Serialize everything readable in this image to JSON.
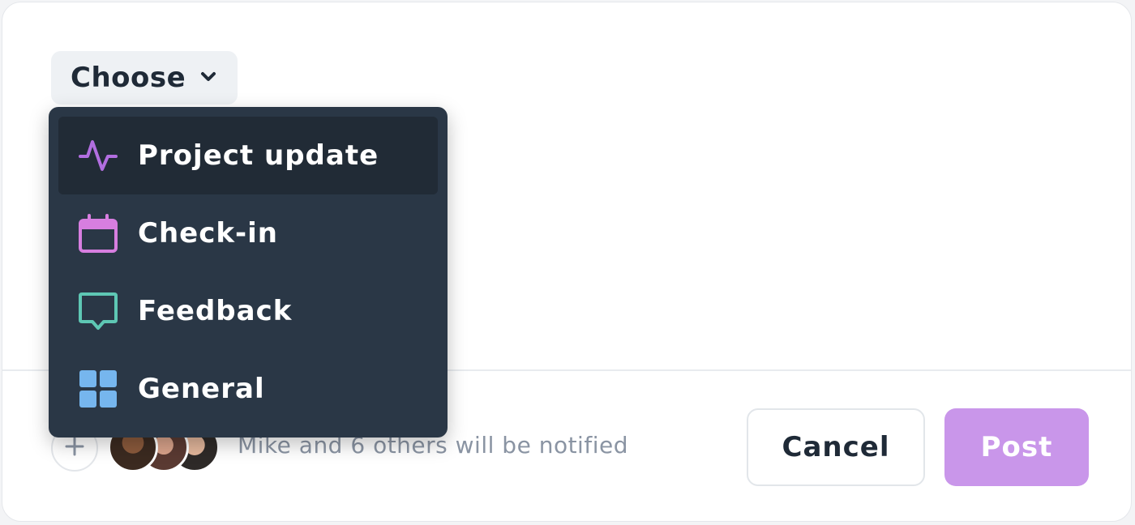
{
  "chooser": {
    "label": "Choose",
    "icon": "chevron-down-icon"
  },
  "menu": {
    "items": [
      {
        "label": "Project update",
        "icon": "activity-icon",
        "color": "#b26ee0",
        "active": true
      },
      {
        "label": "Check-in",
        "icon": "calendar-icon",
        "color": "#d77ee0",
        "active": false
      },
      {
        "label": "Feedback",
        "icon": "message-icon",
        "color": "#5ec7b4",
        "active": false
      },
      {
        "label": "General",
        "icon": "grid-icon",
        "color": "#76b6ee",
        "active": false
      }
    ]
  },
  "footer": {
    "add_icon": "plus-icon",
    "notify_text": "Mike and 6 others will be notified",
    "cancel_label": "Cancel",
    "post_label": "Post"
  },
  "colors": {
    "menu_bg": "#2a3746",
    "post_bg": "#c996ea"
  }
}
